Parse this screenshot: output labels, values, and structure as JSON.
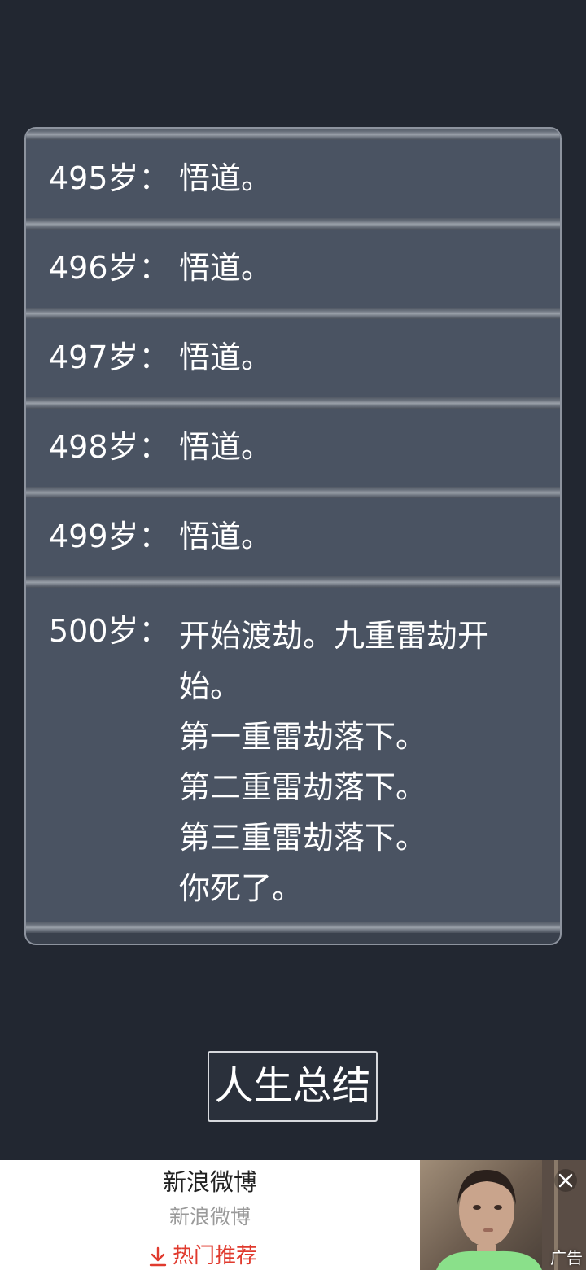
{
  "log": {
    "entries": [
      {
        "age": "495岁：",
        "events": [
          "悟道。"
        ]
      },
      {
        "age": "496岁：",
        "events": [
          "悟道。"
        ]
      },
      {
        "age": "497岁：",
        "events": [
          "悟道。"
        ]
      },
      {
        "age": "498岁：",
        "events": [
          "悟道。"
        ]
      },
      {
        "age": "499岁：",
        "events": [
          "悟道。"
        ]
      },
      {
        "age": "500岁：",
        "events": [
          "开始渡劫。九重雷劫开",
          "始。",
          "第一重雷劫落下。",
          "第二重雷劫落下。",
          "第三重雷劫落下。",
          "你死了。"
        ]
      }
    ]
  },
  "summary_button": {
    "label": "人生总结"
  },
  "ad": {
    "title": "新浪微博",
    "subtitle": "新浪微博",
    "cta_label": "热门推荐",
    "ad_label": "广告",
    "icons": {
      "cta": "download-icon",
      "close": "close-icon"
    },
    "colors": {
      "cta": "#e03a2e"
    }
  }
}
